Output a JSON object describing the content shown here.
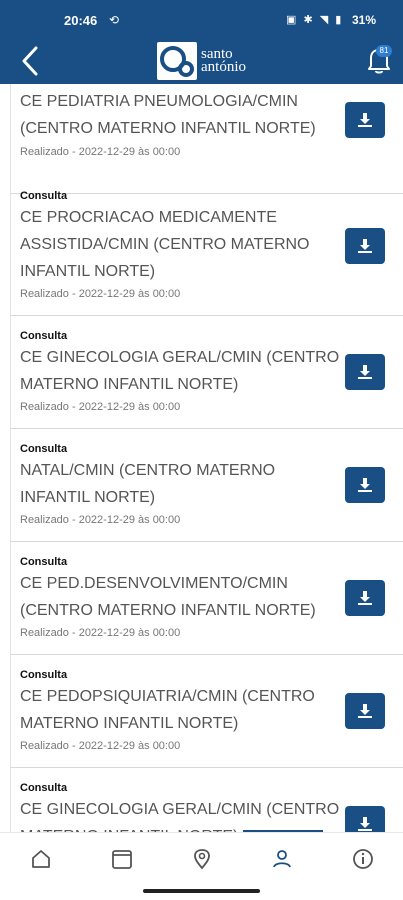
{
  "status_bar": {
    "time": "20:46",
    "battery": "31%"
  },
  "app_bar": {
    "logo_line1": "santo",
    "logo_line2": "antónio",
    "notification_count": "81"
  },
  "items": [
    {
      "type": "",
      "title": "CE PEDIATRIA PNEUMOLOGIA/CMIN (CENTRO MATERNO INFANTIL NORTE)",
      "meta": "Realizado - 2022-12-29 às 00:00"
    },
    {
      "type": "Consulta",
      "title": "CE PROCRIACAO MEDICAMENTE ASSISTIDA/CMIN (CENTRO MATERNO INFANTIL NORTE)",
      "meta": "Realizado - 2022-12-29 às 00:00"
    },
    {
      "type": "Consulta",
      "title": "CE GINECOLOGIA GERAL/CMIN (CENTRO MATERNO INFANTIL NORTE)",
      "meta": "Realizado - 2022-12-29 às 00:00"
    },
    {
      "type": "Consulta",
      "title": "NATAL/CMIN (CENTRO MATERNO INFANTIL NORTE)",
      "meta": "Realizado - 2022-12-29 às 00:00"
    },
    {
      "type": "Consulta",
      "title": "CE PED.DESENVOLVIMENTO/CMIN (CENTRO MATERNO INFANTIL NORTE)",
      "meta": "Realizado - 2022-12-29 às 00:00"
    },
    {
      "type": "Consulta",
      "title": "CE PEDOPSIQUIATRIA/CMIN (CENTRO MATERNO INFANTIL NORTE)",
      "meta": "Realizado - 2022-12-29 às 00:00"
    },
    {
      "type": "Consulta",
      "title": "CE GINECOLOGIA GERAL/CMIN (CENTRO MATERNO INFANTIL NORTE)",
      "meta": ""
    }
  ],
  "icons": {
    "back": "chevron-left-icon",
    "notifications": "bell-icon",
    "download": "download-icon",
    "nav": [
      "home-icon",
      "calendar-icon",
      "location-pin-icon",
      "profile-icon",
      "info-icon"
    ]
  },
  "colors": {
    "primary": "#1a4f85",
    "badge": "#2e7dd1"
  }
}
